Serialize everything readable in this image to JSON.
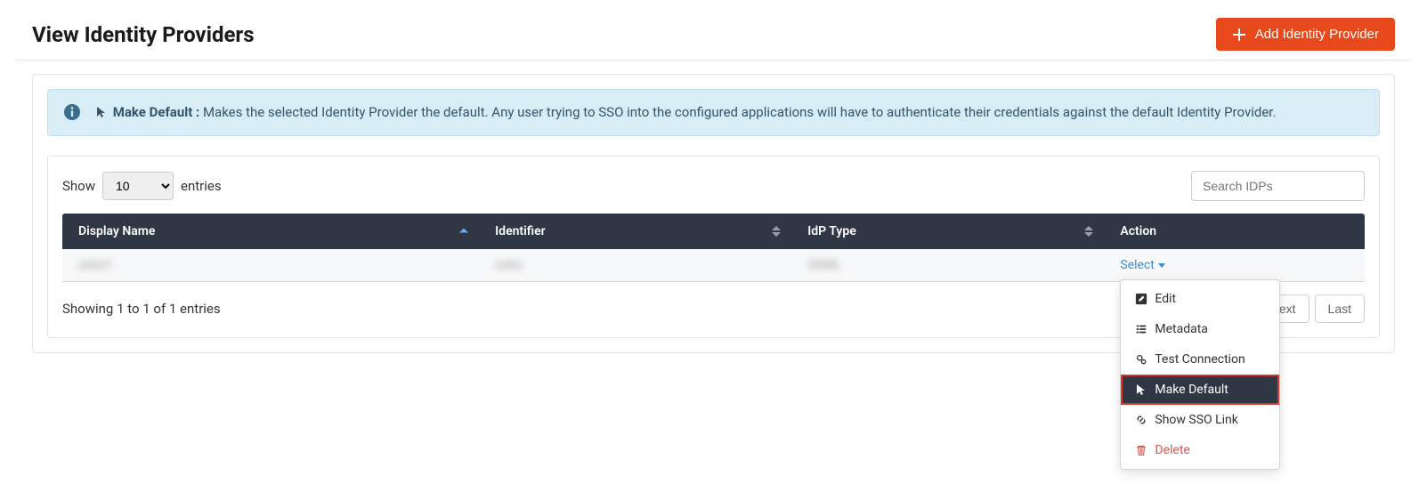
{
  "header": {
    "title": "View Identity Providers",
    "add_button": "Add Identity Provider"
  },
  "info": {
    "title": "Make Default :",
    "description": " Makes the selected Identity Provider the default. Any user trying to SSO into the configured applications will have to authenticate their credentials against the default Identity Provider."
  },
  "table": {
    "show_label_pre": "Show",
    "show_label_post": "entries",
    "show_value": "10",
    "search_placeholder": "Search IDPs",
    "columns": {
      "display_name": "Display Name",
      "identifier": "Identifier",
      "idp_type": "IdP Type",
      "action": "Action"
    },
    "rows": [
      {
        "display_name": "zoho1",
        "identifier": "zoho",
        "idp_type": "SAML",
        "action_label": "Select"
      }
    ],
    "info_text": "Showing 1 to 1 of 1 entries",
    "pagination": {
      "next": "Next",
      "last": "Last"
    }
  },
  "dropdown": {
    "edit": "Edit",
    "metadata": "Metadata",
    "test_connection": "Test Connection",
    "make_default": "Make Default",
    "show_sso_link": "Show SSO Link",
    "delete": "Delete"
  }
}
